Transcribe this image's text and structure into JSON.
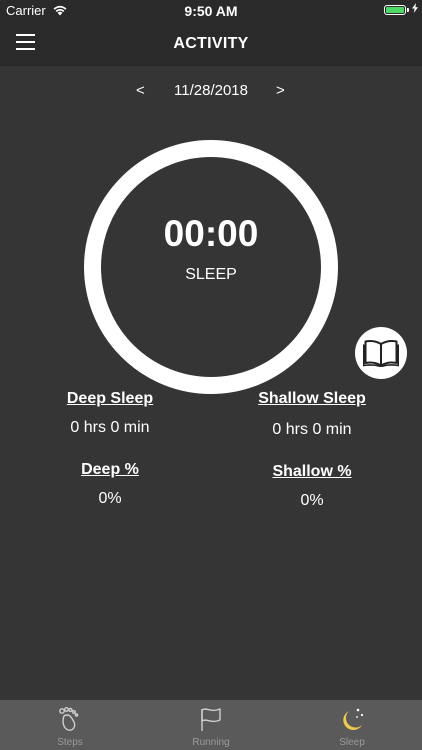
{
  "status": {
    "carrier": "Carrier",
    "time": "9:50 AM"
  },
  "nav": {
    "title": "ACTIVITY"
  },
  "date": {
    "prev": "<",
    "value": "11/28/2018",
    "next": ">"
  },
  "ring": {
    "time": "00:00",
    "label": "SLEEP"
  },
  "stats": {
    "deep_sleep_label": "Deep Sleep",
    "deep_sleep_value": "0 hrs 0 min",
    "shallow_sleep_label": "Shallow Sleep",
    "shallow_sleep_value": "0 hrs 0 min",
    "deep_pct_label": "Deep %",
    "deep_pct_value": "0%",
    "shallow_pct_label": "Shallow %",
    "shallow_pct_value": "0%"
  },
  "tabs": [
    {
      "label": "Steps",
      "icon": "footprint-icon"
    },
    {
      "label": "Running",
      "icon": "flag-icon"
    },
    {
      "label": "Sleep",
      "icon": "moon-icon"
    }
  ],
  "colors": {
    "background": "#353535",
    "bars": "#2a2a2a",
    "tab_bar": "#5a5a5a",
    "active_tab": "#f2c94c",
    "battery": "#4cd964"
  }
}
